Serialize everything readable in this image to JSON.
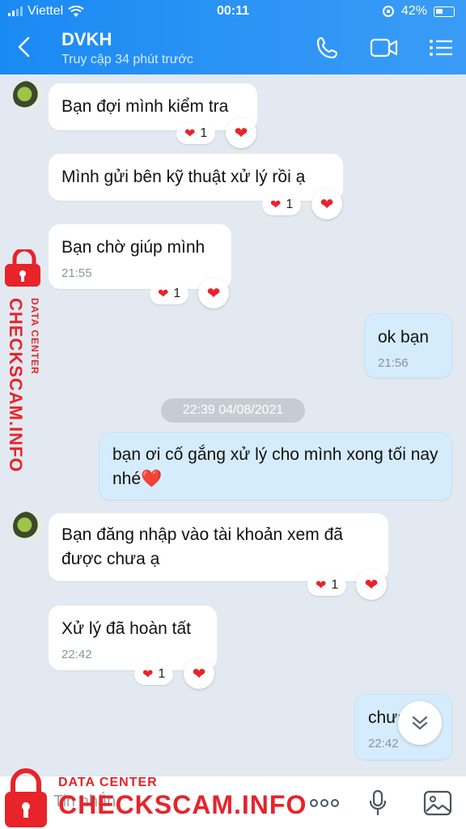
{
  "status": {
    "carrier": "Viettel",
    "time": "00:11",
    "battery": "42%"
  },
  "header": {
    "title": "DVKH",
    "subtitle": "Truy cập 34 phút trước"
  },
  "messages": [
    {
      "text": "Bạn đợi mình kiểm tra",
      "reaction_count": "1"
    },
    {
      "text": "Mình gửi bên kỹ thuật xử lý rồi ạ",
      "reaction_count": "1"
    },
    {
      "text": "Bạn chờ giúp mình",
      "time": "21:55",
      "reaction_count": "1"
    },
    {
      "text": "ok bạn",
      "time": "21:56"
    },
    {
      "text": "bạn ơi cố gắng xử lý cho mình xong tối nay nhé❤️"
    },
    {
      "text": "Bạn đăng nhập vào tài khoản xem đã được chưa ạ",
      "reaction_count": "1"
    },
    {
      "text": "Xử lý đã hoàn tất",
      "time": "22:42",
      "reaction_count": "1"
    },
    {
      "text": "chưa",
      "time": "22:42"
    }
  ],
  "date_separator": "22:39 04/08/2021",
  "input": {
    "placeholder": "Tin nhắn"
  },
  "watermark": {
    "top_text": "DATA CENTER",
    "main_text": "CHECKSCAM.INFO"
  },
  "colors": {
    "header": "#1a8af3",
    "outgoing_bubble": "#d5ecfd",
    "heart": "#e8232a"
  }
}
